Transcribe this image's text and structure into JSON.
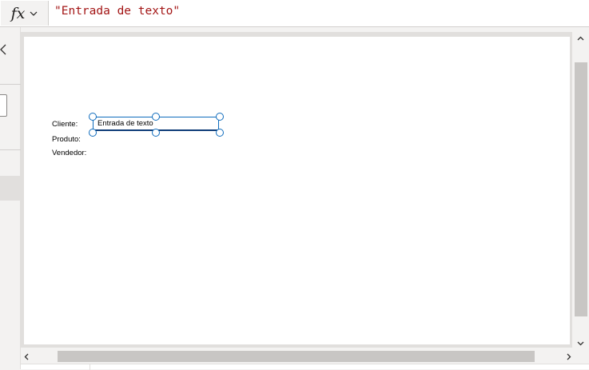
{
  "formula_bar": {
    "fx_label": "fx",
    "formula": "\"Entrada de texto\""
  },
  "canvas": {
    "labels": {
      "cliente": "Cliente:",
      "produto": "Produto:",
      "vendedor": "Vendedor:"
    },
    "text_input": {
      "value": "Entrada de texto"
    }
  },
  "colors": {
    "selection": "#0f6cbd",
    "formula_string": "#a31515"
  },
  "icons": {
    "fx_dropdown": "chevron-down-icon",
    "panel_collapse": "chevron-left-icon",
    "scroll_up": "chevron-up-icon",
    "scroll_down": "chevron-down-icon",
    "scroll_left": "chevron-left-icon",
    "scroll_right": "chevron-right-icon"
  }
}
